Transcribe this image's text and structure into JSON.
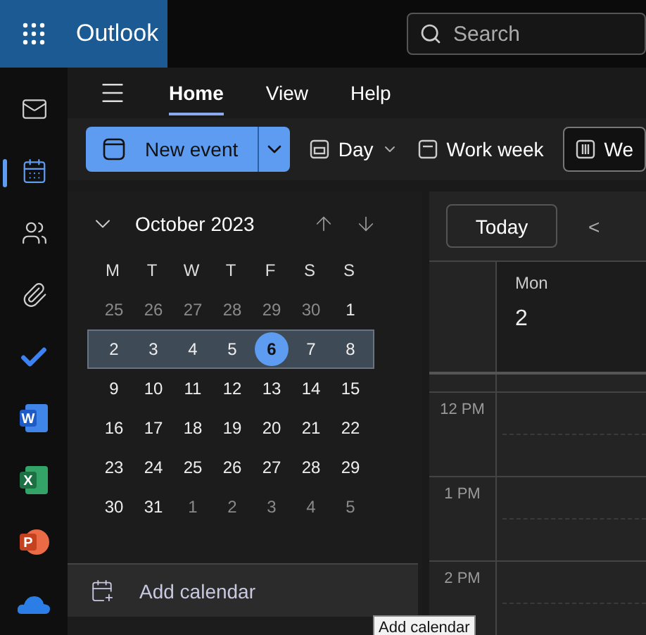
{
  "app": {
    "title": "Outlook"
  },
  "search": {
    "placeholder": "Search"
  },
  "rail": [
    {
      "kind": "mail",
      "selected": false
    },
    {
      "kind": "calendar",
      "selected": true
    },
    {
      "kind": "people",
      "selected": false
    },
    {
      "kind": "attach",
      "selected": false
    },
    {
      "kind": "todo",
      "selected": false
    },
    {
      "kind": "word",
      "letter": "W",
      "selected": false
    },
    {
      "kind": "excel",
      "letter": "X",
      "selected": false
    },
    {
      "kind": "powerpoint",
      "letter": "P",
      "selected": false
    },
    {
      "kind": "cloud",
      "selected": false
    }
  ],
  "tabs": [
    {
      "label": "Home",
      "selected": true
    },
    {
      "label": "View",
      "selected": false
    },
    {
      "label": "Help",
      "selected": false
    }
  ],
  "toolbar": {
    "new_event": "New event",
    "views": [
      {
        "kind": "day",
        "label": "Day",
        "selected": false
      },
      {
        "kind": "workweek",
        "label": "Work week",
        "selected": false
      },
      {
        "kind": "week",
        "label": "We",
        "selected": true
      }
    ]
  },
  "mini_calendar": {
    "title": "October 2023",
    "weekdays": [
      "M",
      "T",
      "W",
      "T",
      "F",
      "S",
      "S"
    ],
    "weeks": [
      {
        "selected": false,
        "days": [
          {
            "label": "25",
            "other_month": true,
            "today": false
          },
          {
            "label": "26",
            "other_month": true,
            "today": false
          },
          {
            "label": "27",
            "other_month": true,
            "today": false
          },
          {
            "label": "28",
            "other_month": true,
            "today": false
          },
          {
            "label": "29",
            "other_month": true,
            "today": false
          },
          {
            "label": "30",
            "other_month": true,
            "today": false
          },
          {
            "label": "1",
            "other_month": false,
            "today": false
          }
        ]
      },
      {
        "selected": true,
        "days": [
          {
            "label": "2",
            "other_month": false,
            "today": false
          },
          {
            "label": "3",
            "other_month": false,
            "today": false
          },
          {
            "label": "4",
            "other_month": false,
            "today": false
          },
          {
            "label": "5",
            "other_month": false,
            "today": false
          },
          {
            "label": "6",
            "other_month": false,
            "today": true
          },
          {
            "label": "7",
            "other_month": false,
            "today": false
          },
          {
            "label": "8",
            "other_month": false,
            "today": false
          }
        ]
      },
      {
        "selected": false,
        "days": [
          {
            "label": "9",
            "other_month": false,
            "today": false
          },
          {
            "label": "10",
            "other_month": false,
            "today": false
          },
          {
            "label": "11",
            "other_month": false,
            "today": false
          },
          {
            "label": "12",
            "other_month": false,
            "today": false
          },
          {
            "label": "13",
            "other_month": false,
            "today": false
          },
          {
            "label": "14",
            "other_month": false,
            "today": false
          },
          {
            "label": "15",
            "other_month": false,
            "today": false
          }
        ]
      },
      {
        "selected": false,
        "days": [
          {
            "label": "16",
            "other_month": false,
            "today": false
          },
          {
            "label": "17",
            "other_month": false,
            "today": false
          },
          {
            "label": "18",
            "other_month": false,
            "today": false
          },
          {
            "label": "19",
            "other_month": false,
            "today": false
          },
          {
            "label": "20",
            "other_month": false,
            "today": false
          },
          {
            "label": "21",
            "other_month": false,
            "today": false
          },
          {
            "label": "22",
            "other_month": false,
            "today": false
          }
        ]
      },
      {
        "selected": false,
        "days": [
          {
            "label": "23",
            "other_month": false,
            "today": false
          },
          {
            "label": "24",
            "other_month": false,
            "today": false
          },
          {
            "label": "25",
            "other_month": false,
            "today": false
          },
          {
            "label": "26",
            "other_month": false,
            "today": false
          },
          {
            "label": "27",
            "other_month": false,
            "today": false
          },
          {
            "label": "28",
            "other_month": false,
            "today": false
          },
          {
            "label": "29",
            "other_month": false,
            "today": false
          }
        ]
      },
      {
        "selected": false,
        "days": [
          {
            "label": "30",
            "other_month": false,
            "today": false
          },
          {
            "label": "31",
            "other_month": false,
            "today": false
          },
          {
            "label": "1",
            "other_month": true,
            "today": false
          },
          {
            "label": "2",
            "other_month": true,
            "today": false
          },
          {
            "label": "3",
            "other_month": true,
            "today": false
          },
          {
            "label": "4",
            "other_month": true,
            "today": false
          },
          {
            "label": "5",
            "other_month": true,
            "today": false
          }
        ]
      }
    ]
  },
  "add_calendar": {
    "label": "Add calendar"
  },
  "day_view": {
    "today_button": "Today",
    "previous": "<",
    "day_name": "Mon",
    "day_number": "2",
    "times": [
      "12 PM",
      "1 PM",
      "2 PM"
    ]
  },
  "tooltip": {
    "text": "Add calendar"
  }
}
